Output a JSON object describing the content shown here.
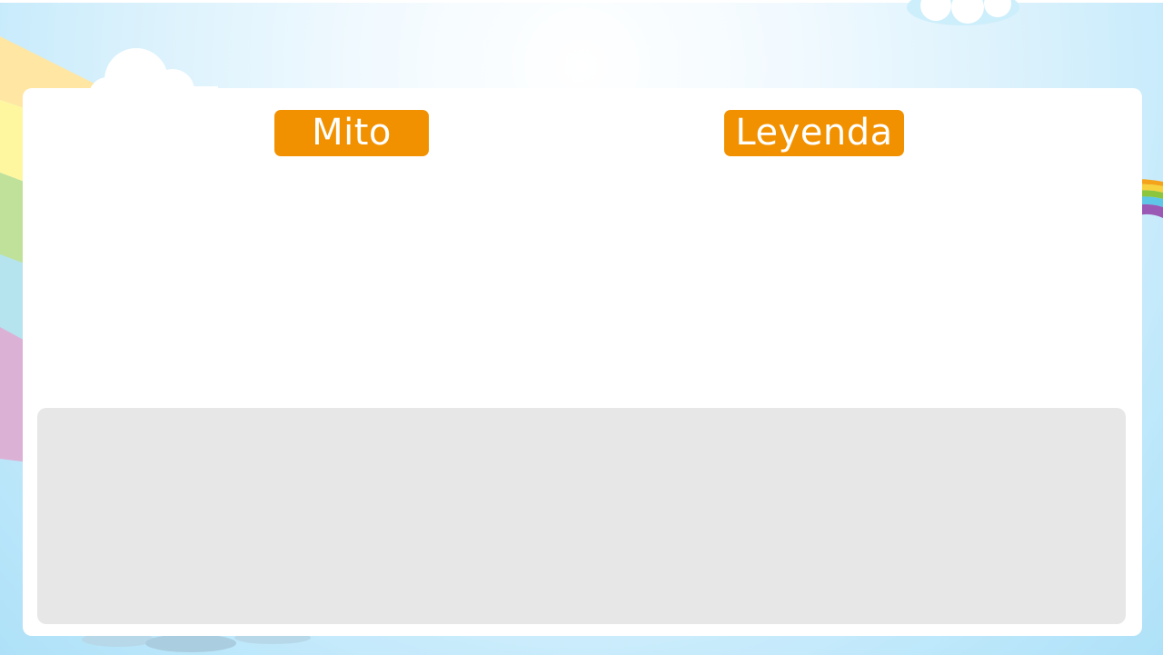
{
  "slide": {
    "left_label": "Mito",
    "right_label": "Leyenda"
  },
  "colors": {
    "label_background": "#f29100",
    "label_text": "#ffffff",
    "card_background": "#ffffff",
    "content_box_background": "#e7e7e7",
    "sky": "#bfe8fb"
  },
  "decorations": {
    "icons": [
      "rainbow-icon",
      "cloud-icon"
    ]
  }
}
